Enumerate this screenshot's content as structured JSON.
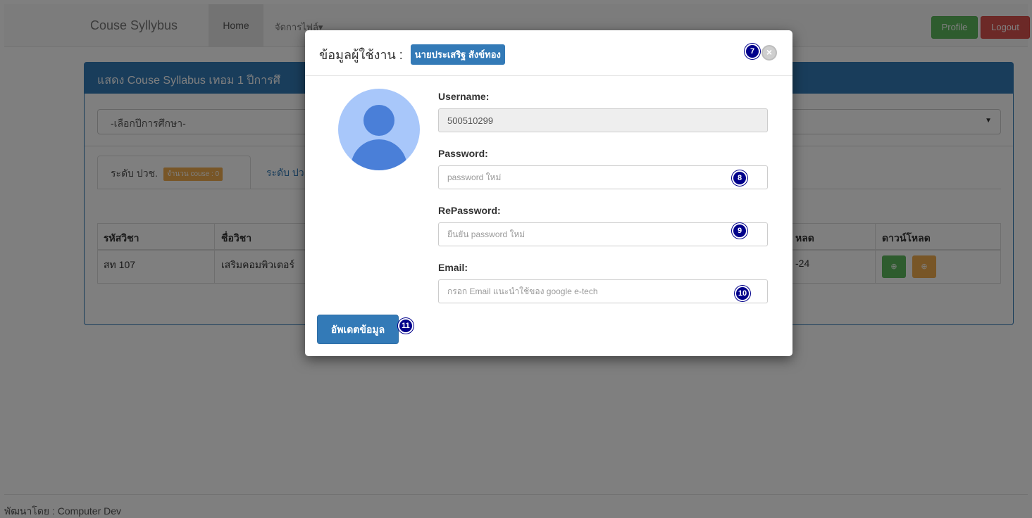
{
  "navbar": {
    "brand": "Couse Syllybus",
    "home": "Home",
    "files_menu": "จัดการไฟล์▾",
    "profile_button": "Profile",
    "logout_button": "Logout"
  },
  "panel": {
    "heading": "แสดง Couse Syllabus เทอม 1 ปีการศึ",
    "select_value": "-เลือกปีการศึกษา-",
    "tabs": [
      {
        "label": "ระดับ ปวช.",
        "badge": "จำนวน couse : 0"
      },
      {
        "label": "ระดับ ปว"
      }
    ],
    "table": {
      "headers": [
        "รหัสวิชา",
        "ชื่อวิชา",
        "หลด",
        "ดาวน์โหลด"
      ],
      "rows": [
        {
          "code": "สท 107",
          "name": "เสริมคอมพิวเตอร์",
          "date": "-24"
        }
      ],
      "download_icon": "⊕"
    }
  },
  "footer": "พัฒนาโดย : Computer Dev",
  "modal": {
    "title": "ข้อมูลผู้ใช้งาน :",
    "user_name": "นายประเสริฐ สังข์ทอง",
    "close_icon": "×",
    "fields": {
      "username": {
        "label": "Username:",
        "value": "500510299"
      },
      "password": {
        "label": "Password:",
        "placeholder": "password ใหม่"
      },
      "repassword": {
        "label": "RePassword:",
        "placeholder": "ยืนยัน password ใหม่"
      },
      "email": {
        "label": "Email:",
        "placeholder": "กรอก Email แนะนำใช้ของ google e-tech"
      }
    },
    "update_button": "อัพเดตข้อมูล"
  },
  "markers": [
    "7",
    "8",
    "9",
    "10",
    "11"
  ],
  "colors": {
    "primary": "#337ab7",
    "success": "#5cb85c",
    "warning": "#f0ad4e",
    "danger": "#d9534f",
    "marker": "#00008b"
  }
}
